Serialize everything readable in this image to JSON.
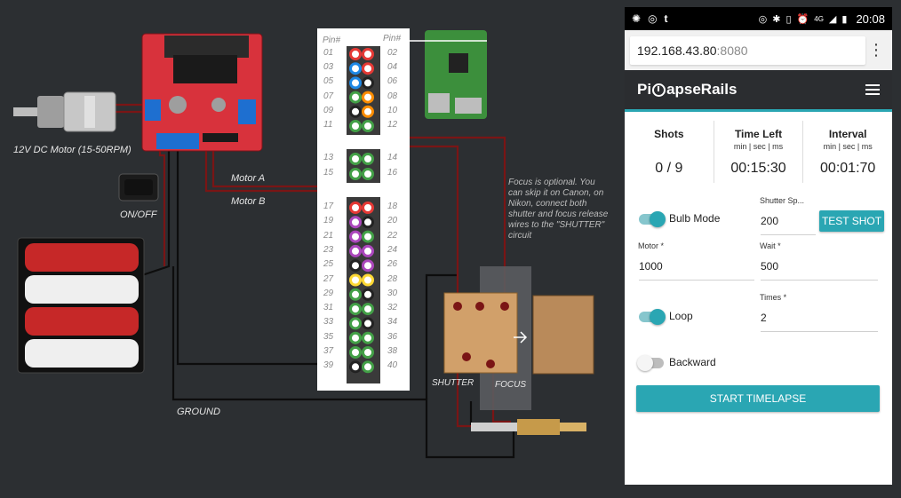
{
  "diagram": {
    "labels": {
      "motor": "12V DC Motor (15-50RPM)",
      "onoff": "ON/OFF",
      "motor_a": "Motor A",
      "motor_b": "Motor B",
      "ground": "GROUND",
      "shutter": "SHUTTER",
      "focus": "FOCUS",
      "pin_left": "Pin#",
      "pin_right": "Pin#",
      "note": "Focus is optional. You can skip it on Canon, on Nikon, connect both shutter and focus release wires to the \"SHUTTER\" circuit"
    },
    "pins_left": [
      "01",
      "03",
      "05",
      "07",
      "09",
      "11",
      "13",
      "15",
      "17",
      "19",
      "21",
      "23",
      "25",
      "27",
      "29",
      "31",
      "33",
      "35",
      "37",
      "39"
    ],
    "pins_right": [
      "02",
      "04",
      "06",
      "08",
      "10",
      "12",
      "14",
      "16",
      "18",
      "20",
      "22",
      "24",
      "26",
      "28",
      "30",
      "32",
      "34",
      "36",
      "38",
      "40"
    ],
    "pin_colors_left": [
      "#e53935",
      "#1e88e5",
      "#1e88e5",
      "#43a047",
      "#222222",
      "#43a047",
      "#43a047",
      "#43a047",
      "#e53935",
      "#ab47bc",
      "#ab47bc",
      "#ab47bc",
      "#222222",
      "#fdd835",
      "#43a047",
      "#43a047",
      "#43a047",
      "#43a047",
      "#43a047",
      "#222222"
    ],
    "pin_colors_right": [
      "#e53935",
      "#e53935",
      "#222222",
      "#fb8c00",
      "#fb8c00",
      "#43a047",
      "#43a047",
      "#43a047",
      "#e53935",
      "#222222",
      "#43a047",
      "#ab47bc",
      "#ab47bc",
      "#fdd835",
      "#222222",
      "#43a047",
      "#222222",
      "#43a047",
      "#43a047",
      "#43a047"
    ],
    "colors": {
      "wire_red": "#7a1515",
      "wire_black": "#0d0d0d",
      "board_red": "#d8323c",
      "header": "#3a3a3a"
    }
  },
  "phone": {
    "status_time": "20:08",
    "status_net": "4G",
    "url_host": "192.168.43.80",
    "url_port": ":8080",
    "app_title_pre": "Pi",
    "app_title_post": "apseRails",
    "stats": [
      {
        "head": "Shots",
        "sub": "",
        "value": "0 / 9"
      },
      {
        "head": "Time Left",
        "sub": "min | sec | ms",
        "value": "00:15:30"
      },
      {
        "head": "Interval",
        "sub": "min | sec | ms",
        "value": "00:01:70"
      }
    ],
    "bulb_mode": {
      "label": "Bulb Mode",
      "on": true
    },
    "shutter_speed": {
      "label": "Shutter Sp...",
      "value": "200"
    },
    "test_shot": "TEST SHOT",
    "motor": {
      "label": "Motor *",
      "value": "1000"
    },
    "wait": {
      "label": "Wait *",
      "value": "500"
    },
    "times": {
      "label": "Times *",
      "value": "2"
    },
    "loop": {
      "label": "Loop",
      "on": true
    },
    "backward": {
      "label": "Backward",
      "on": false
    },
    "start": "START TIMELAPSE"
  }
}
